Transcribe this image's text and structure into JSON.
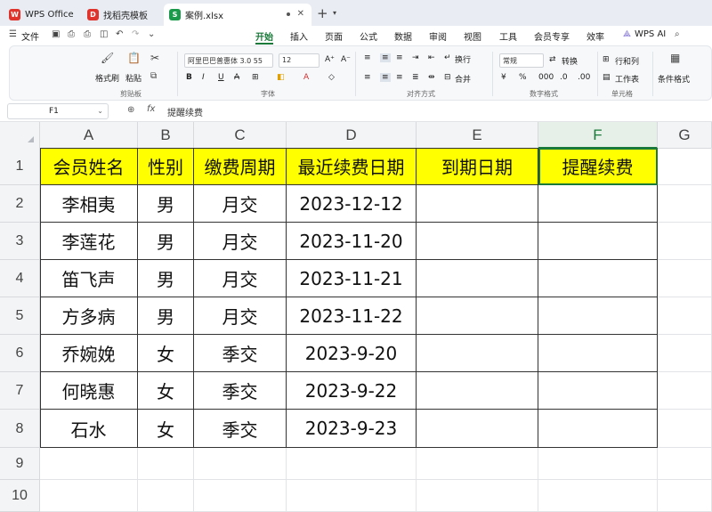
{
  "tabs": [
    {
      "label": "WPS Office",
      "icon": "wps-logo-icon",
      "color": "#e0332b"
    },
    {
      "label": "找稻壳模板",
      "icon": "docer-icon",
      "color": "#e0332b"
    },
    {
      "label": "案例.xlsx",
      "icon": "spreadsheet-icon",
      "color": "#1a9a4a",
      "active": true
    }
  ],
  "menubar": {
    "file": "文件",
    "items": [
      "开始",
      "插入",
      "页面",
      "公式",
      "数据",
      "审阅",
      "视图",
      "工具",
      "会员专享",
      "效率"
    ],
    "active": "开始",
    "wps_ai": "WPS AI"
  },
  "ribbon": {
    "format_painter": "格式刷",
    "paste": "粘贴",
    "clipboard_group": "剪贴板",
    "font_name": "阿里巴巴普惠体 3.0 55",
    "font_size": "12",
    "font_group": "字体",
    "wrap": "换行",
    "merge": "合并",
    "align_group": "对齐方式",
    "number_format": "常规",
    "convert": "转换",
    "number_group": "数字格式",
    "rows_cols": "行和列",
    "worksheet": "工作表",
    "cell_group": "单元格",
    "cond_format": "条件格式"
  },
  "formula_bar": {
    "cell_ref": "F1",
    "fx": "fx",
    "content": "提醒续费"
  },
  "columns": [
    "A",
    "B",
    "C",
    "D",
    "E",
    "F",
    "G"
  ],
  "selected_column": "F",
  "rows": [
    "1",
    "2",
    "3",
    "4",
    "5",
    "6",
    "7",
    "8",
    "9",
    "10"
  ],
  "sheet": {
    "headers": [
      "会员姓名",
      "性别",
      "缴费周期",
      "最近续费日期",
      "到期日期",
      "提醒续费"
    ],
    "header_fill": "#ffff00",
    "records": [
      [
        "李相夷",
        "男",
        "月交",
        "2023-12-12",
        "",
        ""
      ],
      [
        "李莲花",
        "男",
        "月交",
        "2023-11-20",
        "",
        ""
      ],
      [
        "笛飞声",
        "男",
        "月交",
        "2023-11-21",
        "",
        ""
      ],
      [
        "方多病",
        "男",
        "月交",
        "2023-11-22",
        "",
        ""
      ],
      [
        "乔婉娩",
        "女",
        "季交",
        "2023-9-20",
        "",
        ""
      ],
      [
        "何晓惠",
        "女",
        "季交",
        "2023-9-22",
        "",
        ""
      ],
      [
        "石水",
        "女",
        "季交",
        "2023-9-23",
        "",
        ""
      ]
    ]
  },
  "accent_color": "#1a7a3a"
}
